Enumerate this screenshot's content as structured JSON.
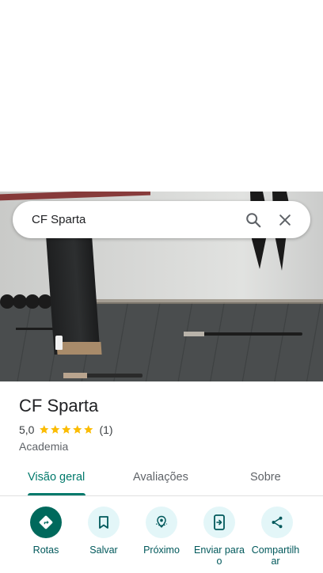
{
  "search": {
    "query": "CF Sparta"
  },
  "place": {
    "name": "CF Sparta",
    "rating": "5,0",
    "stars": 5,
    "review_count": "(1)",
    "category": "Academia"
  },
  "tabs": [
    {
      "label": "Visão geral",
      "active": true
    },
    {
      "label": "Avaliações",
      "active": false
    },
    {
      "label": "Sobre",
      "active": false
    }
  ],
  "actions": [
    {
      "label": "Rotas",
      "icon": "directions-icon"
    },
    {
      "label": "Salvar",
      "icon": "bookmark-icon"
    },
    {
      "label": "Próximo",
      "icon": "nearby-icon"
    },
    {
      "label": "Enviar para o",
      "icon": "send-to-phone-icon"
    },
    {
      "label": "Compartilhar",
      "icon": "share-icon"
    }
  ],
  "colors": {
    "accent": "#00796b",
    "star": "#fbbc04",
    "action_bg": "#e3f6f8",
    "primary_action": "#00695c"
  }
}
